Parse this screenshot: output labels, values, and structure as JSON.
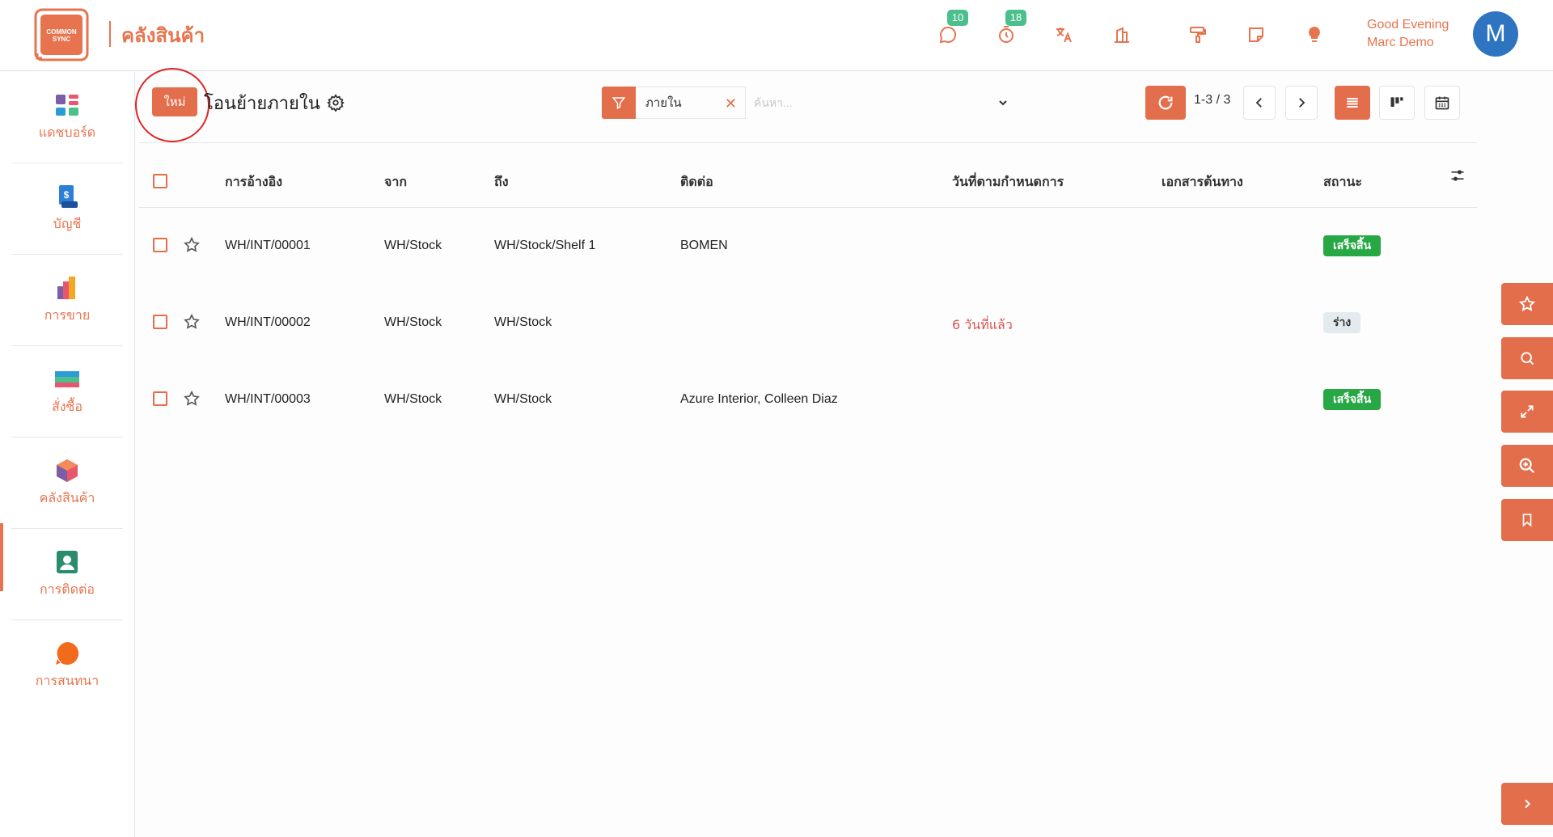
{
  "app": {
    "logo_text": "COMMON SYNC",
    "title": "คลังสินค้า",
    "greeting_line1": "Good Evening",
    "greeting_line2": "Marc Demo",
    "avatar_letter": "M",
    "accent_color": "#e36e4c"
  },
  "header_icons": [
    {
      "name": "chat-icon",
      "badge": "10"
    },
    {
      "name": "timer-icon",
      "badge": "18"
    },
    {
      "name": "translate-icon"
    },
    {
      "name": "company-icon"
    },
    {
      "name": "paint-roller-icon"
    },
    {
      "name": "note-icon"
    },
    {
      "name": "lightbulb-icon"
    }
  ],
  "sidebar": {
    "items": [
      {
        "label": "แดชบอร์ด",
        "icon": "dashboard-icon"
      },
      {
        "label": "บัญชี",
        "icon": "accounting-icon"
      },
      {
        "label": "การขาย",
        "icon": "sales-icon"
      },
      {
        "label": "สั่งซื้อ",
        "icon": "purchase-icon"
      },
      {
        "label": "คลังสินค้า",
        "icon": "inventory-icon",
        "active": true
      },
      {
        "label": "การติดต่อ",
        "icon": "contacts-icon"
      },
      {
        "label": "การสนทนา",
        "icon": "discuss-icon"
      }
    ]
  },
  "control": {
    "new_label": "ใหม่",
    "page_title": "โอนย้ายภายใน",
    "filter_facet": "ภายใน",
    "search_placeholder": "ค้นหา...",
    "pager": "1-3 / 3"
  },
  "table": {
    "columns": [
      "การอ้างอิง",
      "จาก",
      "ถึง",
      "ติดต่อ",
      "วันที่ตามกำหนดการ",
      "เอกสารต้นทาง",
      "สถานะ"
    ],
    "rows": [
      {
        "ref": "WH/INT/00001",
        "from": "WH/Stock",
        "to": "WH/Stock/Shelf 1",
        "contact": "BOMEN",
        "scheduled": "",
        "source": "",
        "status": "เสร็จสิ้น",
        "status_kind": "done"
      },
      {
        "ref": "WH/INT/00002",
        "from": "WH/Stock",
        "to": "WH/Stock",
        "contact": "",
        "scheduled": "6 วันที่แล้ว",
        "source": "",
        "status": "ร่าง",
        "status_kind": "draft"
      },
      {
        "ref": "WH/INT/00003",
        "from": "WH/Stock",
        "to": "WH/Stock",
        "contact": "Azure Interior, Colleen Diaz",
        "scheduled": "",
        "source": "",
        "status": "เสร็จสิ้น",
        "status_kind": "done"
      }
    ]
  },
  "floating_buttons": [
    "star-icon",
    "search-icon",
    "expand-icon",
    "zoom-icon",
    "bookmark-icon",
    "chevron-right-icon"
  ]
}
